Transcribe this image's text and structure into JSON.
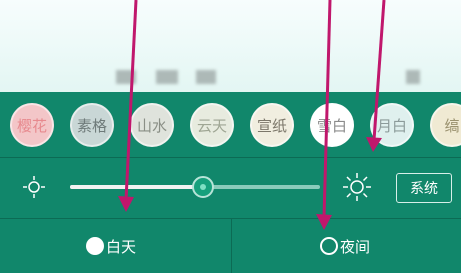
{
  "themes": [
    {
      "label": "樱花",
      "color": "#f3c6c8",
      "text_color": "#e7898e"
    },
    {
      "label": "素格",
      "color": "#c9d7d6",
      "text_color": "#6f7b7a"
    },
    {
      "label": "山水",
      "color": "#dfe3dc",
      "text_color": "#8a8f86"
    },
    {
      "label": "云天",
      "color": "#e7ebdf",
      "text_color": "#9fa694"
    },
    {
      "label": "宣纸",
      "color": "#f1eee0",
      "text_color": "#7c776a"
    },
    {
      "label": "雪白",
      "color": "#ffffff",
      "text_color": "#8b8b8b"
    },
    {
      "label": "月白",
      "color": "#dff0ee",
      "text_color": "#8c9b9a"
    },
    {
      "label": "缟",
      "color": "#f0ead3",
      "text_color": "#9a916e"
    }
  ],
  "brightness": {
    "level": 0.53
  },
  "system_button": {
    "label": "系统"
  },
  "modes": {
    "day": {
      "label": "白天"
    },
    "night": {
      "label": "夜间"
    }
  },
  "colors": {
    "panel": "#11876b",
    "annotation_arrow": "#c0176c"
  }
}
